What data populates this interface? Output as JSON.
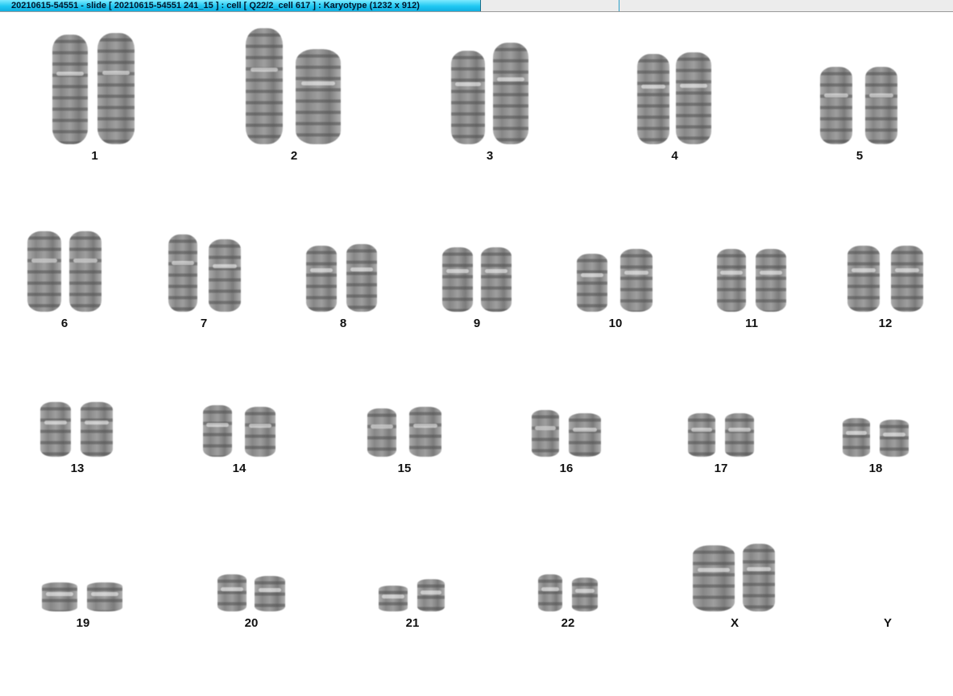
{
  "window": {
    "title": "20210615-54551 - slide [ 20210615-54551 241_15 ] : cell [ Q22/2_cell 617 ] : Karyotype  (1232 x 912)"
  },
  "karyotype": {
    "pairs": [
      {
        "label": "1"
      },
      {
        "label": "2"
      },
      {
        "label": "3"
      },
      {
        "label": "4"
      },
      {
        "label": "5"
      },
      {
        "label": "6"
      },
      {
        "label": "7"
      },
      {
        "label": "8"
      },
      {
        "label": "9"
      },
      {
        "label": "10"
      },
      {
        "label": "11"
      },
      {
        "label": "12"
      },
      {
        "label": "13"
      },
      {
        "label": "14"
      },
      {
        "label": "15"
      },
      {
        "label": "16"
      },
      {
        "label": "17"
      },
      {
        "label": "18"
      },
      {
        "label": "19"
      },
      {
        "label": "20"
      },
      {
        "label": "21"
      },
      {
        "label": "22"
      },
      {
        "label": "X"
      },
      {
        "label": "Y"
      }
    ]
  }
}
